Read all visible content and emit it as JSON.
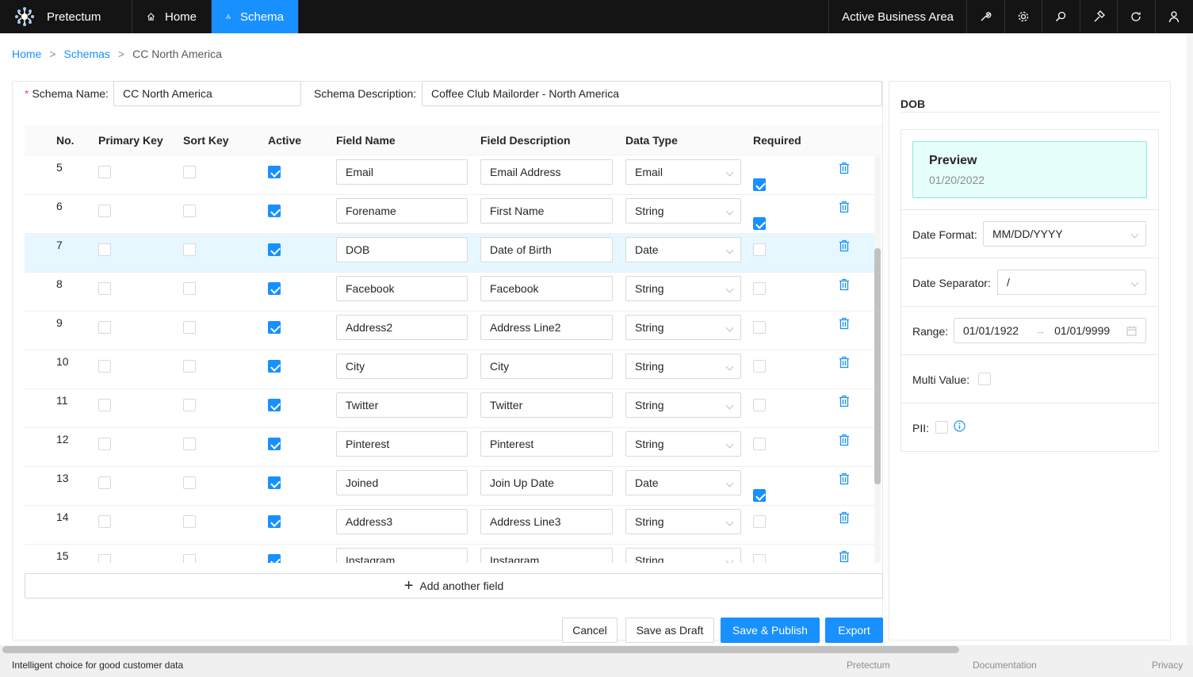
{
  "app": {
    "name": "Pretectum"
  },
  "nav": {
    "home": "Home",
    "schema": "Schema",
    "business_area": "Active Business Area"
  },
  "breadcrumb": {
    "home": "Home",
    "schemas": "Schemas",
    "current": "CC North America",
    "sep": ">"
  },
  "form": {
    "schema_name_label": "Schema Name",
    "schema_name_value": "CC North America",
    "schema_desc_label": "Schema Description",
    "schema_desc_value": "Coffee Club Mailorder - North America",
    "colon": ":",
    "required_mark": "*"
  },
  "table": {
    "headers": [
      "No.",
      "Primary Key",
      "Sort Key",
      "Active",
      "Field Name",
      "Field Description",
      "Data Type",
      "Required"
    ],
    "rows": [
      {
        "no": "5",
        "pk": false,
        "sk": false,
        "active": true,
        "name": "Email",
        "desc": "Email Address",
        "type": "Email",
        "required": true
      },
      {
        "no": "6",
        "pk": false,
        "sk": false,
        "active": true,
        "name": "Forename",
        "desc": "First Name",
        "type": "String",
        "required": true
      },
      {
        "no": "7",
        "pk": false,
        "sk": false,
        "active": true,
        "name": "DOB",
        "desc": "Date of Birth",
        "type": "Date",
        "required": false,
        "selected": true
      },
      {
        "no": "8",
        "pk": false,
        "sk": false,
        "active": true,
        "name": "Facebook",
        "desc": "Facebook",
        "type": "String",
        "required": false
      },
      {
        "no": "9",
        "pk": false,
        "sk": false,
        "active": true,
        "name": "Address2",
        "desc": "Address Line2",
        "type": "String",
        "required": false
      },
      {
        "no": "10",
        "pk": false,
        "sk": false,
        "active": true,
        "name": "City",
        "desc": "City",
        "type": "String",
        "required": false
      },
      {
        "no": "11",
        "pk": false,
        "sk": false,
        "active": true,
        "name": "Twitter",
        "desc": "Twitter",
        "type": "String",
        "required": false
      },
      {
        "no": "12",
        "pk": false,
        "sk": false,
        "active": true,
        "name": "Pinterest",
        "desc": "Pinterest",
        "type": "String",
        "required": false
      },
      {
        "no": "13",
        "pk": false,
        "sk": false,
        "active": true,
        "name": "Joined",
        "desc": "Join Up Date",
        "type": "Date",
        "required": true
      },
      {
        "no": "14",
        "pk": false,
        "sk": false,
        "active": true,
        "name": "Address3",
        "desc": "Address Line3",
        "type": "String",
        "required": false
      },
      {
        "no": "15",
        "pk": false,
        "sk": false,
        "active": true,
        "name": "Instagram",
        "desc": "Instagram",
        "type": "String",
        "required": false
      }
    ]
  },
  "actions": {
    "add_field": "Add another field",
    "cancel": "Cancel",
    "save_draft": "Save as Draft",
    "save_publish": "Save & Publish",
    "export": "Export"
  },
  "detail": {
    "title": "DOB",
    "preview_title": "Preview",
    "preview_value": "01/20/2022",
    "date_format_label": "Date Format",
    "date_format_value": "MM/DD/YYYY",
    "date_separator_label": "Date Separator",
    "date_separator_value": "/",
    "range_label": "Range",
    "range_from": "01/01/1922",
    "range_to": "01/01/9999",
    "range_arrow": "→",
    "multi_value_label": "Multi Value",
    "pii_label": "PII"
  },
  "footer": {
    "tagline": "Intelligent choice for good customer data",
    "link1": "Pretectum",
    "link2": "Documentation",
    "link3": "Privacy"
  },
  "colors": {
    "accent": "#1890ff",
    "topbar": "#141414",
    "selected_row": "#e6f7ff",
    "preview_bg": "#e6fffb"
  }
}
